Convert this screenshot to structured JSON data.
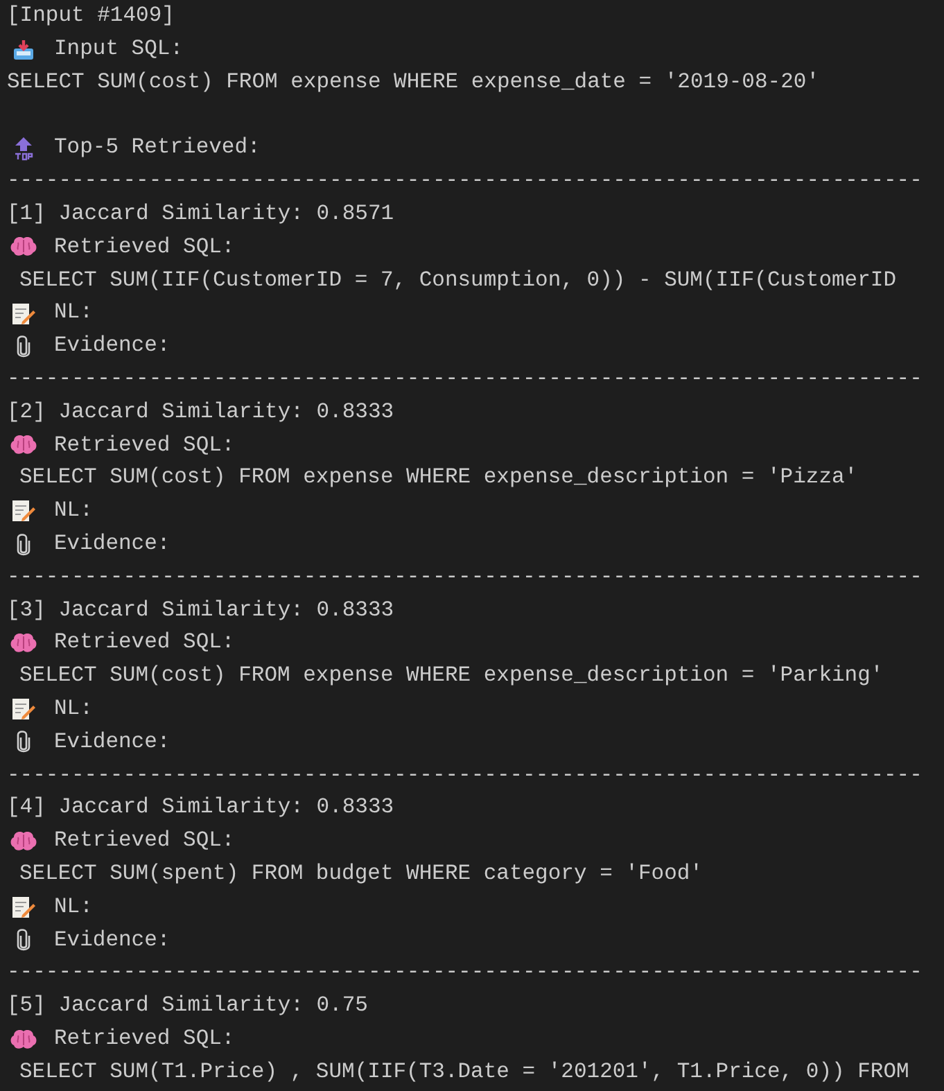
{
  "header": "[Input #1409]",
  "input": {
    "label": "Input SQL:",
    "sql": "SELECT SUM(cost) FROM expense WHERE expense_date = '2019-08-20'"
  },
  "top_label": "Top-5 Retrieved:",
  "results": [
    {
      "separator": "-----------------------------------------------------------------------",
      "heading": "[1] Jaccard Similarity: 0.8571",
      "retrieved_label": "Retrieved SQL:",
      "sql": "SELECT SUM(IIF(CustomerID = 7, Consumption, 0)) - SUM(IIF(CustomerID",
      "nl_label": "NL:",
      "evidence_label": "Evidence:"
    },
    {
      "separator": "-----------------------------------------------------------------------",
      "heading": "[2] Jaccard Similarity: 0.8333",
      "retrieved_label": "Retrieved SQL:",
      "sql": "SELECT SUM(cost) FROM expense WHERE expense_description = 'Pizza'",
      "nl_label": "NL:",
      "evidence_label": "Evidence:"
    },
    {
      "separator": "-----------------------------------------------------------------------",
      "heading": "[3] Jaccard Similarity: 0.8333",
      "retrieved_label": "Retrieved SQL:",
      "sql": "SELECT SUM(cost) FROM expense WHERE expense_description = 'Parking'",
      "nl_label": "NL:",
      "evidence_label": "Evidence:"
    },
    {
      "separator": "-----------------------------------------------------------------------",
      "heading": "[4] Jaccard Similarity: 0.8333",
      "retrieved_label": "Retrieved SQL:",
      "sql": "SELECT SUM(spent) FROM budget WHERE category = 'Food'",
      "nl_label": "NL:",
      "evidence_label": "Evidence:"
    },
    {
      "separator": "-----------------------------------------------------------------------",
      "heading": "[5] Jaccard Similarity: 0.75",
      "retrieved_label": "Retrieved SQL:",
      "sql": "SELECT SUM(T1.Price) , SUM(IIF(T3.Date = '201201', T1.Price, 0)) FROM"
    }
  ]
}
